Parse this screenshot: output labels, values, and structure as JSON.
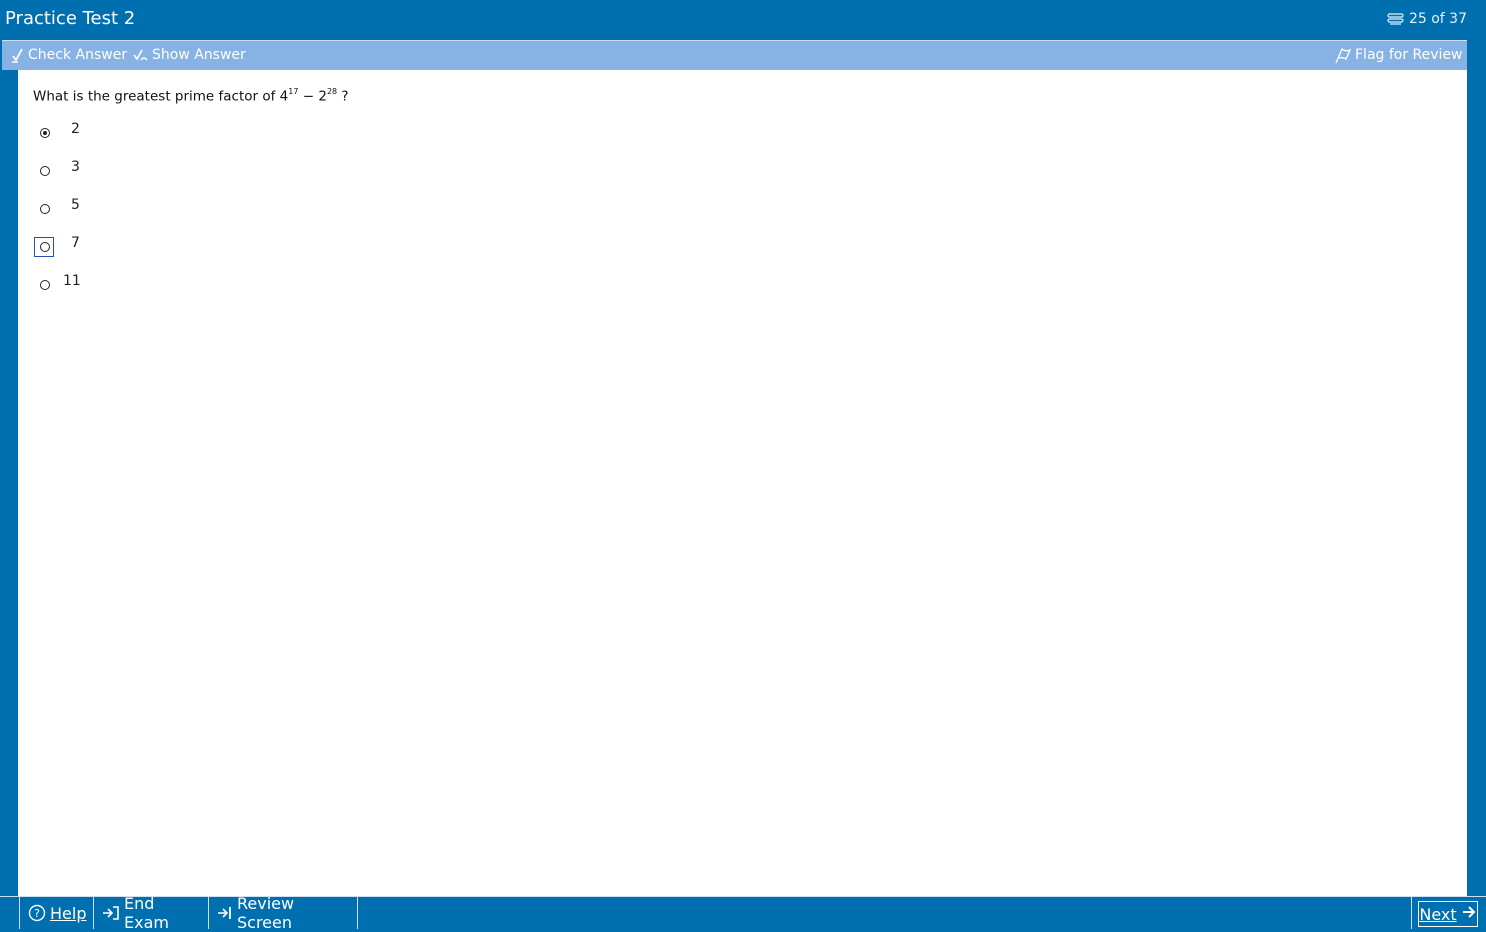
{
  "window": {
    "title": "Practice Test 2",
    "progress": "25 of 37"
  },
  "toolbar": {
    "check_answer": "Check Answer",
    "show_answer": "Show Answer",
    "flag_for_review": "Flag for Review"
  },
  "question": {
    "prefix": "What is the greatest prime factor of 4",
    "exp1": "17",
    "mid": " − 2",
    "exp2": "28",
    "suffix": " ?",
    "choices": [
      {
        "label": "2",
        "selected": true
      },
      {
        "label": "3",
        "selected": false
      },
      {
        "label": "5",
        "selected": false
      },
      {
        "label": "7",
        "selected": false
      },
      {
        "label": "11",
        "selected": false
      }
    ]
  },
  "footer": {
    "help": "Help",
    "end_exam": "End Exam",
    "review_screen": "Review Screen",
    "next": "Next"
  },
  "colors": {
    "frame": "#006fb0",
    "toolbar": "#86b3e3"
  },
  "icons": [
    "progress-icon",
    "check-answer-icon",
    "show-answer-icon",
    "flag-icon",
    "help-icon",
    "end-exam-icon",
    "review-screen-icon",
    "next-arrow-icon"
  ]
}
